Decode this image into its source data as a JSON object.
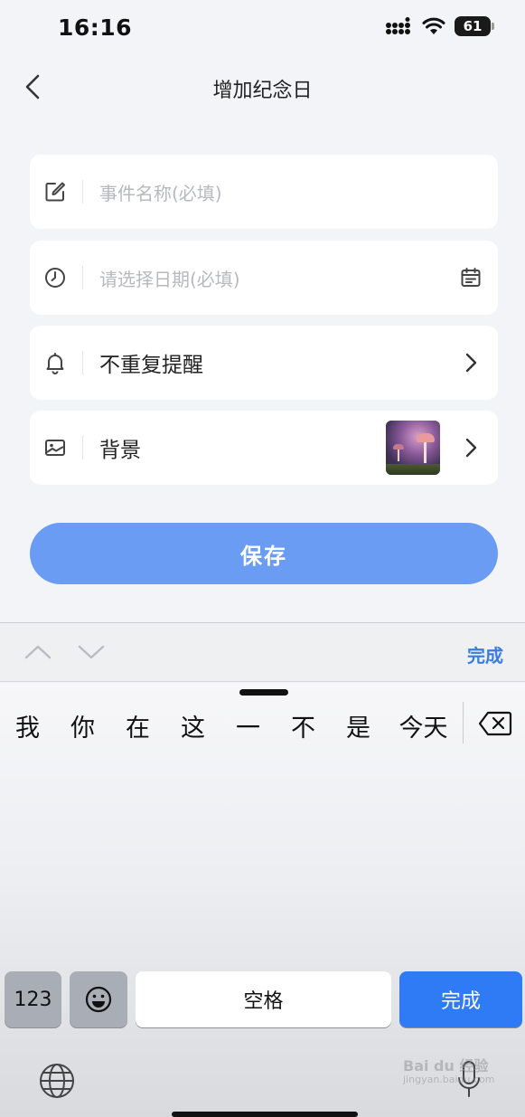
{
  "status_bar": {
    "time": "16:16",
    "battery": "61"
  },
  "nav": {
    "title": "增加纪念日"
  },
  "form": {
    "event_name_placeholder": "事件名称(必填)",
    "date_placeholder": "请选择日期(必填)",
    "reminder_label": "不重复提醒",
    "background_label": "背景"
  },
  "save_label": "保存",
  "accessory": {
    "done_label": "完成"
  },
  "keyboard": {
    "candidates": [
      "我",
      "你",
      "在",
      "这",
      "一",
      "不",
      "是",
      "今天"
    ],
    "key_123": "123",
    "space_label": "空格",
    "return_label": "完成"
  },
  "watermark": {
    "line1": "Bai du 经验",
    "line2": "jingyan.baidu.com"
  },
  "colors": {
    "accent": "#2f7bf5",
    "save_button": "#6a9cf3",
    "link": "#3a7de0"
  },
  "icons": [
    "signal-icon",
    "wifi-icon",
    "battery-icon",
    "back-icon",
    "edit-icon",
    "clock-icon",
    "calendar-icon",
    "bell-icon",
    "image-icon",
    "chevron-right-icon",
    "chevron-up-icon",
    "chevron-down-icon",
    "backspace-icon",
    "emoji-icon",
    "globe-icon",
    "mic-icon"
  ]
}
